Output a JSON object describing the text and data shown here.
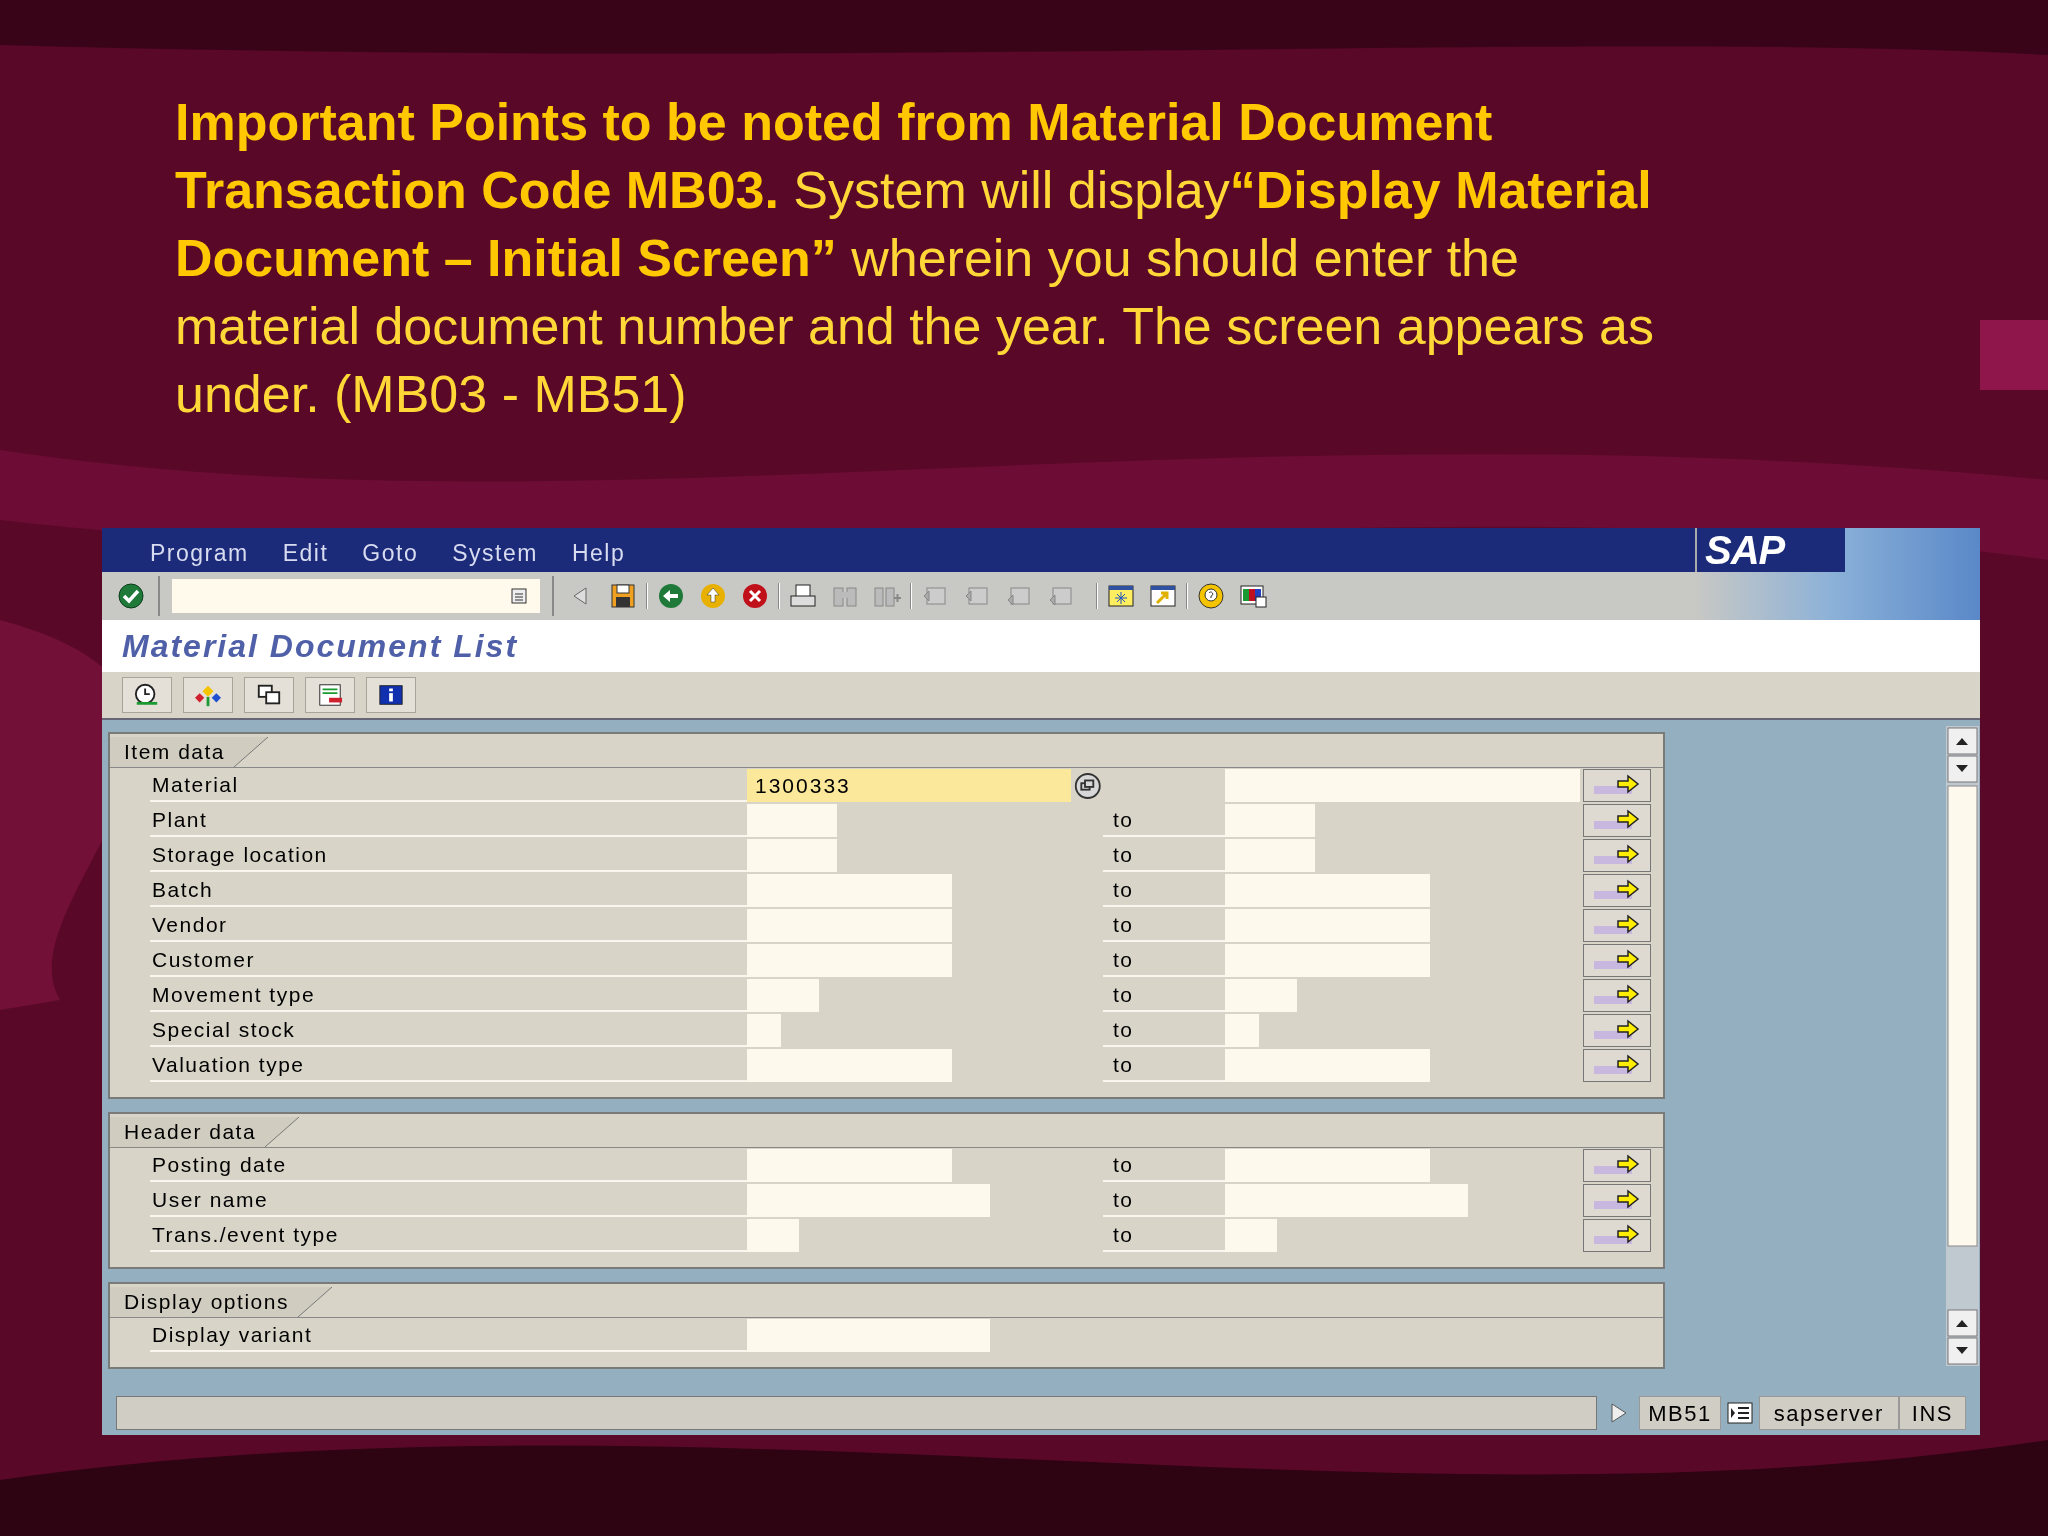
{
  "slide": {
    "text": "**Important Points to be noted from Material Document Transaction Code MB03.** System will display**“Display Material Document – Initial Screen”** wherein  you should enter the material document number and the year. The screen appears as under. (MB03 - MB51)"
  },
  "window": {
    "menu": [
      "Program",
      "Edit",
      "Goto",
      "System",
      "Help"
    ],
    "title": "Material Document List",
    "logo": "SAP"
  },
  "groups": [
    {
      "title": "Item data",
      "rows": [
        {
          "label": "Material",
          "value": "1300333",
          "focused": true,
          "to": "",
          "multiple_selection": true
        },
        {
          "label": "Plant",
          "value": "",
          "focused": false,
          "to": "to",
          "multiple_selection": true
        },
        {
          "label": "Storage location",
          "value": "",
          "focused": false,
          "to": "to",
          "multiple_selection": true
        },
        {
          "label": "Batch",
          "value": "",
          "focused": false,
          "to": "to",
          "multiple_selection": true
        },
        {
          "label": "Vendor",
          "value": "",
          "focused": false,
          "to": "to",
          "multiple_selection": true
        },
        {
          "label": "Customer",
          "value": "",
          "focused": false,
          "to": "to",
          "multiple_selection": true
        },
        {
          "label": "Movement type",
          "value": "",
          "focused": false,
          "to": "to",
          "multiple_selection": true
        },
        {
          "label": "Special stock",
          "value": "",
          "focused": false,
          "to": "to",
          "multiple_selection": true
        },
        {
          "label": "Valuation type",
          "value": "",
          "focused": false,
          "to": "to",
          "multiple_selection": true
        }
      ]
    },
    {
      "title": "Header data",
      "rows": [
        {
          "label": "Posting date",
          "value": "",
          "focused": false,
          "to": "to",
          "multiple_selection": true
        },
        {
          "label": "User name",
          "value": "",
          "focused": false,
          "to": "to",
          "multiple_selection": true
        },
        {
          "label": "Trans./event type",
          "value": "",
          "focused": false,
          "to": "to",
          "multiple_selection": true
        }
      ]
    },
    {
      "title": "Display options",
      "rows": [
        {
          "label": "Display variant",
          "value": "",
          "focused": false,
          "to": "",
          "multiple_selection": false
        }
      ]
    }
  ],
  "status_bar": {
    "transaction": "MB51",
    "server": "sapserver",
    "mode": "INS"
  }
}
